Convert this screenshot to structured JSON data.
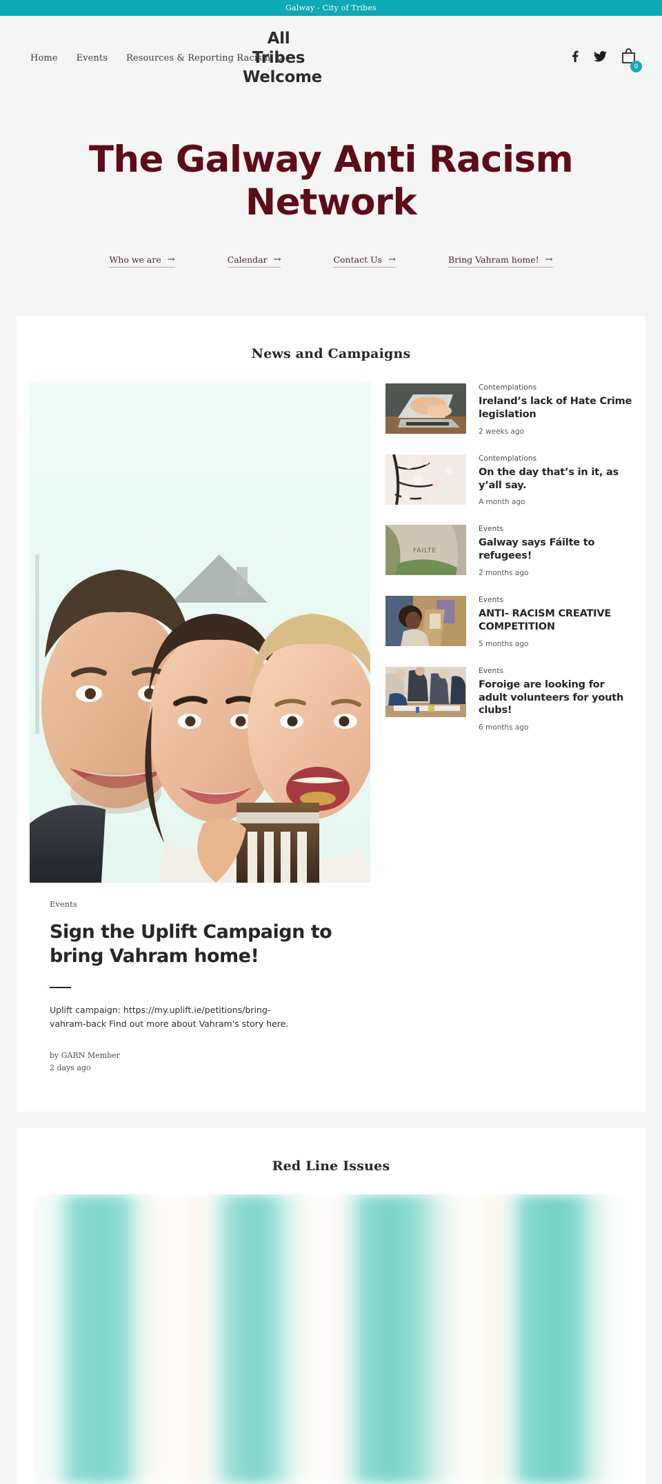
{
  "announcement": {
    "text": "Galway - City of Tribes",
    "bg_color": "#0fa8b5"
  },
  "header": {
    "nav_items": [
      {
        "label": "Home",
        "has_dropdown": false
      },
      {
        "label": "Events",
        "has_dropdown": false
      },
      {
        "label": "Resources & Reporting Racism",
        "has_dropdown": true,
        "icon": "chevron-down-icon"
      }
    ],
    "logo_text": "All Tribes Welcome",
    "social": [
      {
        "name": "facebook-icon",
        "label": "Facebook"
      },
      {
        "name": "twitter-icon",
        "label": "Twitter"
      }
    ],
    "cart": {
      "icon": "shopping-bag-icon",
      "count": "0",
      "badge_color": "#16aab9"
    }
  },
  "hero": {
    "title": "The Galway Anti Racism Network",
    "title_color": "#5c0d18",
    "links": [
      {
        "label": "Who we are",
        "arrow": "→"
      },
      {
        "label": "Calendar",
        "arrow": "→"
      },
      {
        "label": "Contact Us",
        "arrow": "→"
      },
      {
        "label": "Bring Vahram home!",
        "arrow": "→"
      }
    ]
  },
  "news_section": {
    "title": "News and Campaigns",
    "featured": {
      "image_alt": "Family selfie - man, woman and child smiling",
      "category": "Events",
      "title": "Sign the Uplift Campaign to bring Vahram home!",
      "excerpt": "Uplift campaign: https://my.uplift.ie/petitions/bring-vahram-back Find out more about Vahram's story here.",
      "author": "by GARN Member",
      "time": "2 days ago"
    },
    "items": [
      {
        "category": "Contemplations",
        "title": "Ireland’s lack of Hate Crime legislation",
        "time": "2 weeks ago",
        "thumb_alt": "Hands typing on a laptop"
      },
      {
        "category": "Contemplations",
        "title": "On the day that’s in it, as y’all say.",
        "time": "A month ago",
        "thumb_alt": "White blossom on dark branches"
      },
      {
        "category": "Events",
        "title": "Galway says Fáilte to refugees!",
        "time": "2 months ago",
        "thumb_alt": "FÁILTE written in the sand on a beach"
      },
      {
        "category": "Events",
        "title": "ANTI- RACISM CREATIVE COMPETITION",
        "time": "5 months ago",
        "thumb_alt": "Woman painting at an easel"
      },
      {
        "category": "Events",
        "title": "Foroige are looking for adult volunteers for youth clubs!",
        "time": "6 months ago",
        "thumb_alt": "Group of people sitting around a table working"
      }
    ]
  },
  "red_line_section": {
    "title": "Red Line Issues",
    "gallery_alt": "Blurred teal coloured image panels"
  }
}
